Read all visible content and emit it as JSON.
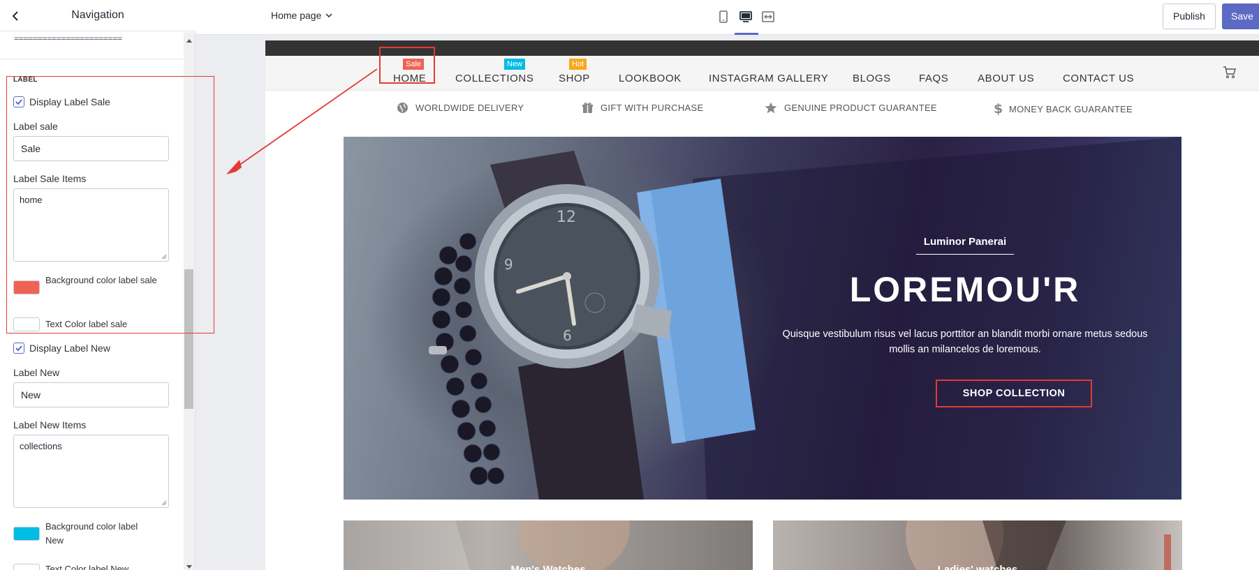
{
  "panel": {
    "title": "Navigation",
    "divider_text": "=======================",
    "section_label": "LABEL",
    "display_label_sale": "Display Label Sale",
    "label_sale_title": "Label sale",
    "label_sale_value": "Sale",
    "label_sale_items_title": "Label Sale Items",
    "label_sale_items_value": "home",
    "bg_color_sale_label": "Background color label sale",
    "bg_color_sale_value": "#ef6354",
    "text_color_sale_label": "Text Color label sale",
    "text_color_sale_value": "#ffffff",
    "display_label_new": "Display Label New",
    "label_new_title": "Label New",
    "label_new_value": "New",
    "label_new_items_title": "Label New Items",
    "label_new_items_value": "collections",
    "bg_color_new_label": "Background color label New",
    "bg_color_new_value": "#00bde4",
    "text_color_new_label": "Text Color label New"
  },
  "topbar": {
    "page_select": "Home page",
    "publish": "Publish",
    "save": "Save"
  },
  "nav": {
    "items": [
      {
        "label": "HOME",
        "badge": "Sale",
        "badge_color": "#ef6354"
      },
      {
        "label": "COLLECTIONS",
        "badge": "New",
        "badge_color": "#00bde4"
      },
      {
        "label": "SHOP",
        "badge": "Hot",
        "badge_color": "#f9a81e"
      },
      {
        "label": "LOOKBOOK"
      },
      {
        "label": "INSTAGRAM GALLERY"
      },
      {
        "label": "BLOGS"
      },
      {
        "label": "FAQS"
      },
      {
        "label": "ABOUT US"
      },
      {
        "label": "CONTACT US"
      }
    ]
  },
  "features": [
    {
      "label": "WORLDWIDE DELIVERY",
      "icon": "globe-icon"
    },
    {
      "label": "GIFT WITH PURCHASE",
      "icon": "gift-icon"
    },
    {
      "label": "GENUINE PRODUCT GUARANTEE",
      "icon": "star-icon"
    },
    {
      "label": "MONEY BACK GUARANTEE",
      "icon": "dollar-icon"
    }
  ],
  "hero": {
    "subtitle": "Luminor Panerai",
    "title": "LOREMOU'R",
    "description": "Quisque vestibulum risus vel lacus porttitor an blandit morbi ornare metus sedous mollis an milancelos de loremous.",
    "cta": "SHOP COLLECTION"
  },
  "promos": [
    {
      "label": "Men's Watches"
    },
    {
      "label": "Ladies' watches"
    }
  ],
  "colors": {
    "accent": "#5c6ac4",
    "annotation": "#e53935"
  }
}
